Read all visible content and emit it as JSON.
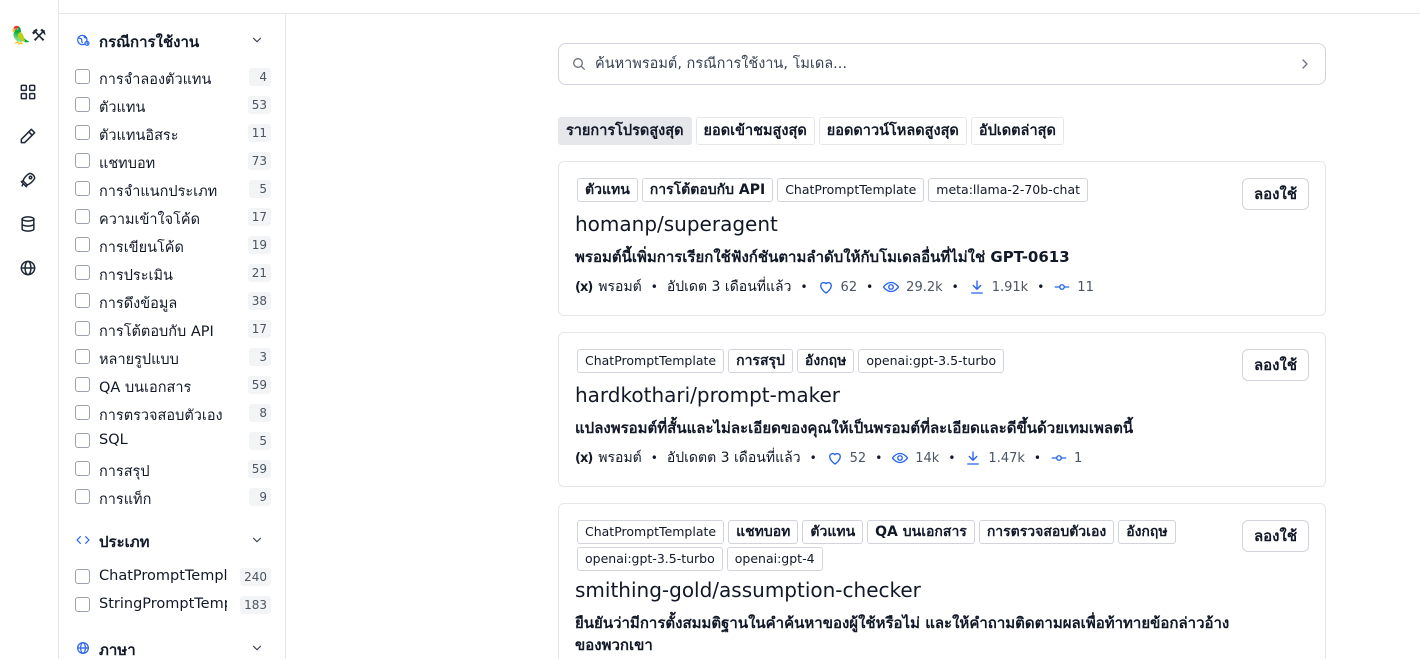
{
  "search": {
    "placeholder": "ค้นหาพรอมต์, กรณีการใช้งาน, โมเดล..."
  },
  "rail": {
    "logo_glyph": "🦜⚒",
    "icons": [
      "grid-icon",
      "pencil-icon",
      "rocket-icon",
      "database-icon",
      "globe-icon"
    ]
  },
  "sidebar": {
    "usecases": {
      "title": "กรณีการใช้งาน",
      "items": [
        {
          "label": "การจำลองตัวแทน",
          "count": "4"
        },
        {
          "label": "ตัวแทน",
          "count": "53"
        },
        {
          "label": "ตัวแทนอิสระ",
          "count": "11"
        },
        {
          "label": "แชทบอท",
          "count": "73"
        },
        {
          "label": "การจำแนกประเภท",
          "count": "5"
        },
        {
          "label": "ความเข้าใจโค้ด",
          "count": "17"
        },
        {
          "label": "การเขียนโค้ด",
          "count": "19"
        },
        {
          "label": "การประเมิน",
          "count": "21"
        },
        {
          "label": "การดึงข้อมูล",
          "count": "38"
        },
        {
          "label": "การโต้ตอบกับ API",
          "count": "17"
        },
        {
          "label": "หลายรูปแบบ",
          "count": "3"
        },
        {
          "label": "QA บนเอกสาร",
          "count": "59"
        },
        {
          "label": "การตรวจสอบตัวเอง",
          "count": "8"
        },
        {
          "label": "SQL",
          "count": "5"
        },
        {
          "label": "การสรุป",
          "count": "59"
        },
        {
          "label": "การแท็ก",
          "count": "9"
        }
      ]
    },
    "types": {
      "title": "ประเภท",
      "items": [
        {
          "label": "ChatPromptTemplate",
          "count": "240"
        },
        {
          "label": "StringPromptTemplate",
          "count": "183"
        }
      ]
    },
    "language": {
      "title": "ภาษา"
    }
  },
  "tabs": [
    {
      "label": "รายการโปรดสูงสุด",
      "active": true
    },
    {
      "label": "ยอดเข้าชมสูงสุด",
      "active": false
    },
    {
      "label": "ยอดดาวน์โหลดสูงสุด",
      "active": false
    },
    {
      "label": "อัปเดตล่าสุด",
      "active": false
    }
  ],
  "cards": [
    {
      "tags": [
        {
          "label": "ตัวแทน",
          "thai": true
        },
        {
          "label": "การโต้ตอบกับ API",
          "thai": true
        },
        {
          "label": "ChatPromptTemplate",
          "thai": false
        },
        {
          "label": "meta:llama-2-70b-chat",
          "thai": false
        }
      ],
      "try_label": "ลองใช้",
      "name": "homanp/superagent",
      "description": "พรอมต์นี้เพิ่มการเรียกใช้ฟังก์ชันตามลำดับให้กับโมเดลอื่นที่ไม่ใช่ GPT-0613",
      "meta": {
        "variable_icon": "(x)",
        "type": "พรอมต์",
        "updated": "อัปเดต 3 เดือนที่แล้ว",
        "likes": "62",
        "views": "29.2k",
        "downloads": "1.91k",
        "forks": "11"
      }
    },
    {
      "tags": [
        {
          "label": "ChatPromptTemplate",
          "thai": false
        },
        {
          "label": "การสรุป",
          "thai": true
        },
        {
          "label": "อังกฤษ",
          "thai": true
        },
        {
          "label": "openai:gpt-3.5-turbo",
          "thai": false
        }
      ],
      "try_label": "ลองใช้",
      "name": "hardkothari/prompt-maker",
      "description": "แปลงพรอมต์ที่สั้นและไม่ละเอียดของคุณให้เป็นพรอมต์ที่ละเอียดและดีขึ้นด้วยเทมเพลตนี้",
      "meta": {
        "variable_icon": "(x)",
        "type": "พรอมต์",
        "updated": "อัปเดตต 3 เดือนที่แล้ว",
        "likes": "52",
        "views": "14k",
        "downloads": "1.47k",
        "forks": "1"
      }
    },
    {
      "tags": [
        {
          "label": "ChatPromptTemplate",
          "thai": false
        },
        {
          "label": "แชทบอท",
          "thai": true
        },
        {
          "label": "ตัวแทน",
          "thai": true
        },
        {
          "label": "QA บนเอกสาร",
          "thai": true
        },
        {
          "label": "การตรวจสอบตัวเอง",
          "thai": true
        },
        {
          "label": "อังกฤษ",
          "thai": true
        },
        {
          "label": "openai:gpt-3.5-turbo",
          "thai": false
        },
        {
          "label": "openai:gpt-4",
          "thai": false
        }
      ],
      "try_label": "ลองใช้",
      "name": "smithing-gold/assumption-checker",
      "description": "ยืนยันว่ามีการตั้งสมมติฐานในคำค้นหาของผู้ใช้หรือไม่ และให้คำถามติดตามผลเพื่อท้าทายข้อกล่าวอ้างของพวกเขา"
    }
  ],
  "colors": {
    "accent": "#2563eb",
    "border": "#e5e7eb",
    "tab_active_bg": "#e5e7eb"
  }
}
